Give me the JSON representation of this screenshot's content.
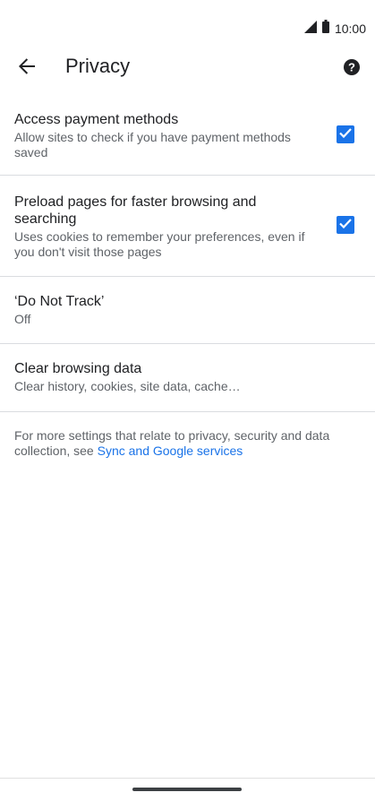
{
  "status_bar": {
    "time": "10:00"
  },
  "appbar": {
    "title": "Privacy"
  },
  "items": [
    {
      "title": "Access payment methods",
      "summary": "Allow sites to check if you have payment methods saved",
      "checked": true
    },
    {
      "title": "Preload pages for faster browsing and searching",
      "summary": "Uses cookies to remember your preferences, even if you don't visit those pages",
      "checked": true
    },
    {
      "title": "‘Do Not Track’",
      "summary": "Off"
    },
    {
      "title": "Clear browsing data",
      "summary": "Clear history, cookies, site data, cache…"
    }
  ],
  "footer": {
    "text": "For more settings that relate to privacy, security and data collection, see ",
    "link": "Sync and Google services"
  },
  "colors": {
    "accent": "#1a73e8",
    "text_primary": "#202124",
    "text_secondary": "#5f6368"
  },
  "icons": [
    "signal-icon",
    "battery-icon",
    "back-arrow-icon",
    "help-icon",
    "checkmark-icon"
  ]
}
